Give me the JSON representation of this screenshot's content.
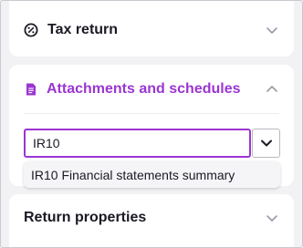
{
  "sections": {
    "tax_return": {
      "title": "Tax return",
      "icon": "percent-circle-icon"
    },
    "attachments": {
      "title": "Attachments and schedules",
      "icon": "document-icon",
      "expanded": true
    },
    "return_properties": {
      "title": "Return properties"
    }
  },
  "search": {
    "value": "IR10"
  },
  "suggestions": [
    {
      "label": "IR10 Financial statements summary"
    }
  ],
  "colors": {
    "accent": "#9b35d1",
    "text": "#1a1a24",
    "chevron": "#9a9aa8"
  }
}
